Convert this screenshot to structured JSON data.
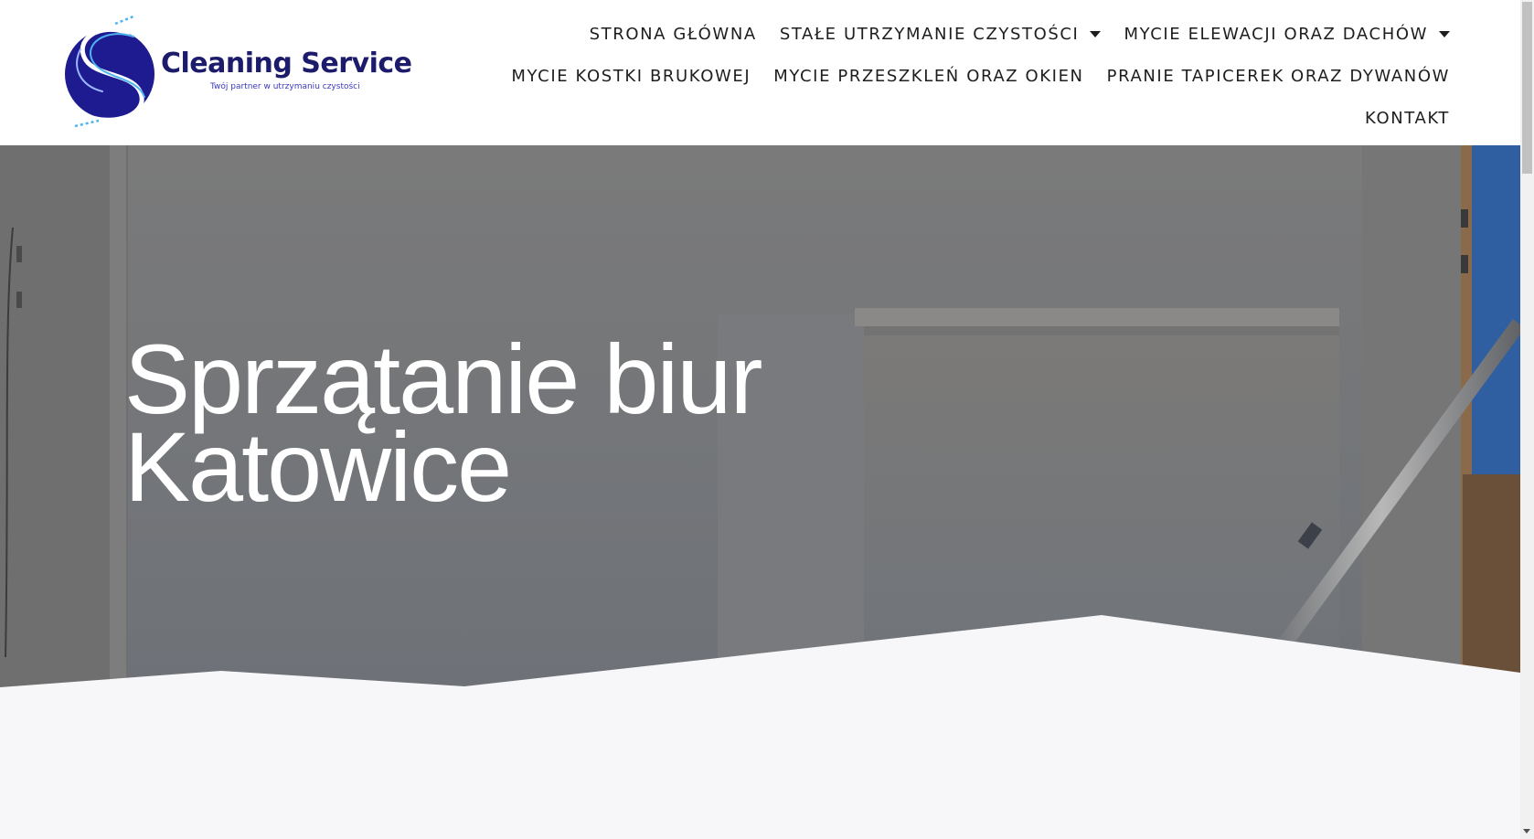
{
  "brand": {
    "name": "Cleaning Service",
    "tagline": "Twój partner  w utrzymaniu czystości",
    "colors": {
      "primary": "#1d1b8f",
      "accent": "#3aa0e6"
    }
  },
  "nav": {
    "rows": [
      [
        {
          "label": "STRONA GŁÓWNA",
          "dropdown": false
        },
        {
          "label": "STAŁE UTRZYMANIE CZYSTOŚCI",
          "dropdown": true
        },
        {
          "label": "MYCIE ELEWACJI ORAZ DACHÓW",
          "dropdown": true
        }
      ],
      [
        {
          "label": "MYCIE KOSTKI BRUKOWEJ",
          "dropdown": false
        },
        {
          "label": "MYCIE PRZESZKLEŃ ORAZ OKIEN",
          "dropdown": false
        },
        {
          "label": "PRANIE TAPICEREK ORAZ DYWANÓW",
          "dropdown": false
        }
      ],
      [
        {
          "label": "KONTAKT",
          "dropdown": false
        }
      ]
    ]
  },
  "hero": {
    "title_line1": "Sprzątanie biur",
    "title_line2": "Katowice"
  }
}
